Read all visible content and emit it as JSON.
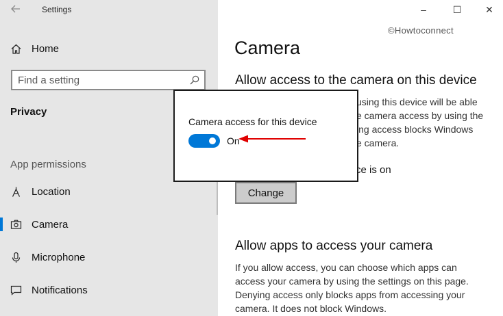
{
  "window": {
    "title": "Settings",
    "controls": [
      "–",
      "☐",
      "✕"
    ]
  },
  "watermark": "©Howtoconnect",
  "sidebar": {
    "home_label": "Home",
    "search_placeholder": "Find a setting",
    "section_title": "Privacy",
    "group_label": "App permissions",
    "items": [
      {
        "label": "Location",
        "icon": "location-icon",
        "active": false
      },
      {
        "label": "Camera",
        "icon": "camera-icon",
        "active": true
      },
      {
        "label": "Microphone",
        "icon": "microphone-icon",
        "active": false
      },
      {
        "label": "Notifications",
        "icon": "notifications-icon",
        "active": false
      }
    ]
  },
  "main": {
    "page_title": "Camera",
    "section1": {
      "heading": "Allow access to the camera on this device",
      "lines": [
        "using this device will be able",
        "e camera access by using the",
        "ing access blocks Windows",
        "e camera."
      ],
      "status": "ce is on",
      "change_label": "Change"
    },
    "section2": {
      "heading": "Allow apps to access your camera",
      "paragraph": "If you allow access, you can choose which apps can access your camera by using the settings on this page. Denying access only blocks apps from accessing your camera. It does not block Windows."
    }
  },
  "dialog": {
    "label": "Camera access for this device",
    "toggle_state": "On",
    "toggle_on": true
  },
  "colors": {
    "accent": "#0078d7",
    "arrow": "#e00000",
    "sidebar_bg": "#e6e6e6"
  }
}
